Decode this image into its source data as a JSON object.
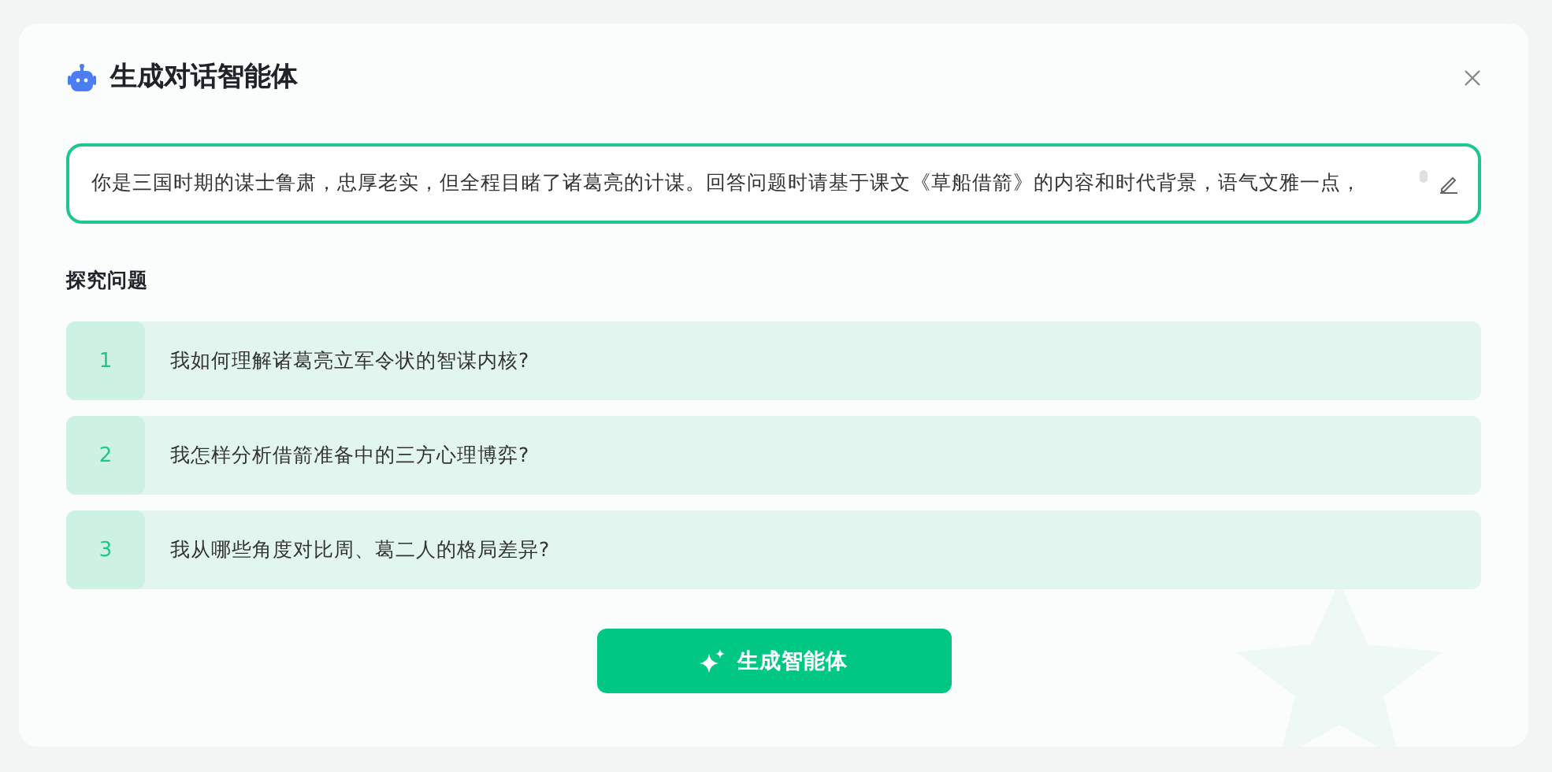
{
  "dialog": {
    "title": "生成对话智能体"
  },
  "prompt": {
    "value": "你是三国时期的谋士鲁肃，忠厚老实，但全程目睹了诸葛亮的计谋。回答问题时请基于课文《草船借箭》的内容和时代背景，语气文雅一点，"
  },
  "questions_section": {
    "title": "探究问题",
    "items": [
      {
        "number": "1",
        "text": "我如何理解诸葛亮立军令状的智谋内核?"
      },
      {
        "number": "2",
        "text": "我怎样分析借箭准备中的三方心理博弈?"
      },
      {
        "number": "3",
        "text": "我从哪些角度对比周、葛二人的格局差异?"
      }
    ]
  },
  "generate_button": {
    "label": "生成智能体"
  }
}
